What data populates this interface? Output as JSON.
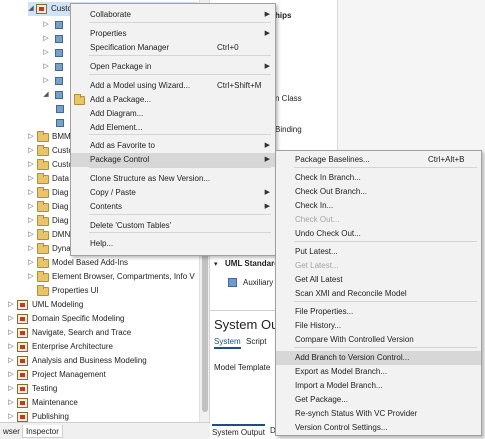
{
  "tree": {
    "top_item": "Custo",
    "items": [
      {
        "label": "BMM"
      },
      {
        "label": "Custo"
      },
      {
        "label": "Custo"
      },
      {
        "label": "Data"
      },
      {
        "label": "Diag"
      },
      {
        "label": "Diag"
      },
      {
        "label": "Diag"
      },
      {
        "label": "DMN"
      },
      {
        "label": "Dyna"
      },
      {
        "label": "Model Based Add-Ins"
      },
      {
        "label": "Element Browser, Compartments, Info V"
      },
      {
        "label": "Properties UI"
      },
      {
        "label": "UML Modeling"
      },
      {
        "label": "Domain Specific Modeling"
      },
      {
        "label": "Navigate, Search and Trace"
      },
      {
        "label": "Enterprise Architecture"
      },
      {
        "label": "Analysis and Business Modeling"
      },
      {
        "label": "Project Management"
      },
      {
        "label": "Testing"
      },
      {
        "label": "Maintenance"
      },
      {
        "label": "Publishing"
      }
    ]
  },
  "bottom_tabs": [
    "wser",
    "Inspector"
  ],
  "right_pane": {
    "hint1": "hips",
    "hint2": "n Class",
    "hint3": "Binding",
    "uml_standard": "UML Standard",
    "auxiliary": "Auxiliary",
    "system_output_title": "System Ou",
    "sys_tabs": [
      "System",
      "Script"
    ],
    "model_template": "Model Template",
    "bottom_tab": "System Output",
    "bottom_tab2": "D"
  },
  "menu_main": {
    "items": [
      {
        "label": "Collaborate",
        "shortcut": "",
        "submenu": true
      },
      {
        "label": "Properties",
        "shortcut": "",
        "submenu": true
      },
      {
        "label": "Specification Manager",
        "shortcut": "Ctrl+0",
        "submenu": false
      },
      {
        "label": "Open Package in",
        "shortcut": "",
        "submenu": true
      },
      {
        "label": "Add a Model using Wizard...",
        "shortcut": "Ctrl+Shift+M",
        "submenu": false
      },
      {
        "label": "Add a Package...",
        "shortcut": "",
        "submenu": false
      },
      {
        "label": "Add Diagram...",
        "shortcut": "",
        "submenu": false
      },
      {
        "label": "Add Element...",
        "shortcut": "",
        "submenu": false
      },
      {
        "label": "Add as Favorite to",
        "shortcut": "",
        "submenu": true
      },
      {
        "label": "Package Control",
        "shortcut": "",
        "submenu": true
      },
      {
        "label": "Clone Structure as New Version...",
        "shortcut": "",
        "submenu": false
      },
      {
        "label": "Copy / Paste",
        "shortcut": "",
        "submenu": true
      },
      {
        "label": "Contents",
        "shortcut": "",
        "submenu": true
      },
      {
        "label": "Delete 'Custom Tables'",
        "shortcut": "",
        "submenu": false
      },
      {
        "label": "Help...",
        "shortcut": "",
        "submenu": false
      }
    ]
  },
  "menu_sub": {
    "items": [
      {
        "label": "Package Baselines...",
        "shortcut": "Ctrl+Alt+B"
      },
      {
        "label": "Check In Branch...",
        "shortcut": ""
      },
      {
        "label": "Check Out Branch...",
        "shortcut": ""
      },
      {
        "label": "Check In...",
        "shortcut": ""
      },
      {
        "label": "Check Out...",
        "shortcut": ""
      },
      {
        "label": "Undo Check Out...",
        "shortcut": ""
      },
      {
        "label": "Put Latest...",
        "shortcut": ""
      },
      {
        "label": "Get Latest...",
        "shortcut": ""
      },
      {
        "label": "Get All Latest",
        "shortcut": ""
      },
      {
        "label": "Scan XMI and Reconcile Model",
        "shortcut": ""
      },
      {
        "label": "File Properties...",
        "shortcut": ""
      },
      {
        "label": "File History...",
        "shortcut": ""
      },
      {
        "label": "Compare With Controlled Version",
        "shortcut": ""
      },
      {
        "label": "Add Branch to Version Control...",
        "shortcut": ""
      },
      {
        "label": "Export as Model Branch...",
        "shortcut": ""
      },
      {
        "label": "Import a Model Branch...",
        "shortcut": ""
      },
      {
        "label": "Get Package...",
        "shortcut": ""
      },
      {
        "label": "Re-synch Status With VC Provider",
        "shortcut": ""
      },
      {
        "label": "Version Control Settings...",
        "shortcut": ""
      }
    ]
  },
  "colors": {
    "highlight": "#d7d7d7",
    "disabled": "#a4a4a4"
  }
}
